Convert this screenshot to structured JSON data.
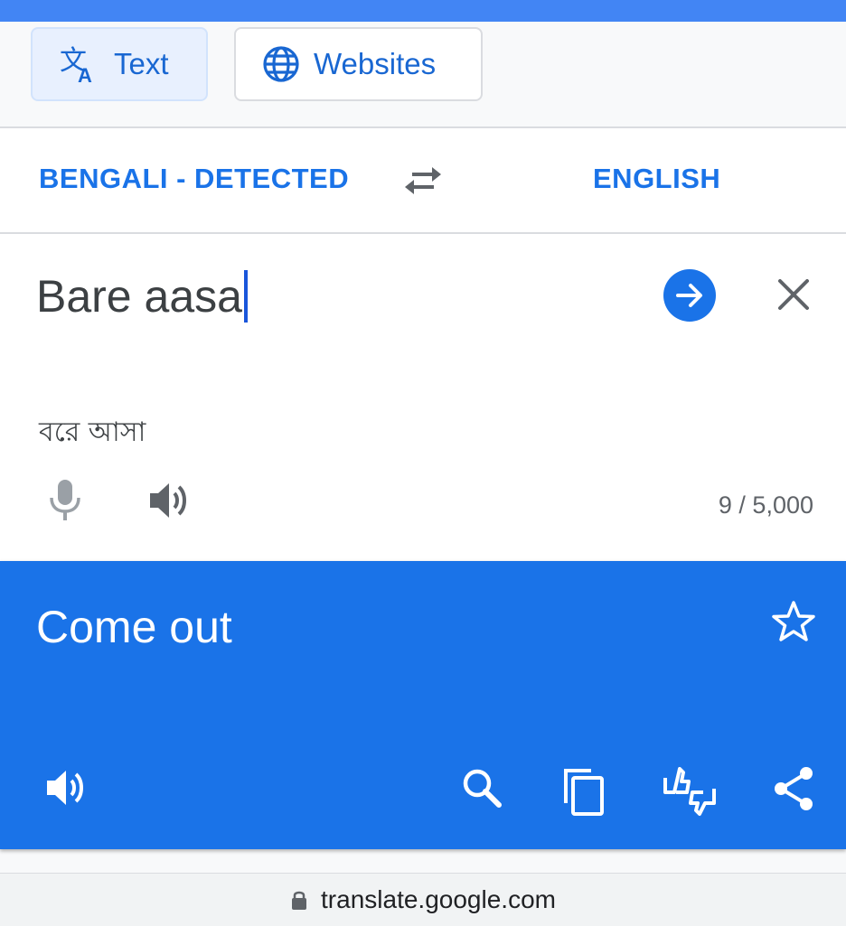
{
  "modes": {
    "text_label": "Text",
    "websites_label": "Websites"
  },
  "languages": {
    "source": "BENGALI - DETECTED",
    "target": "ENGLISH"
  },
  "input": {
    "value": "Bare aasa",
    "transliteration": "বরে আসা",
    "char_count": "9 / 5,000"
  },
  "result": {
    "text": "Come out"
  },
  "browser": {
    "url": "translate.google.com"
  },
  "colors": {
    "accent": "#1a73e8",
    "top_strip": "#4285f4"
  },
  "icons": [
    "translate-icon",
    "globe-icon",
    "swap-icon",
    "arrow-right-icon",
    "close-icon",
    "mic-icon",
    "speaker-icon",
    "star-icon",
    "search-icon",
    "copy-icon",
    "feedback-icon",
    "share-icon",
    "lock-icon"
  ]
}
